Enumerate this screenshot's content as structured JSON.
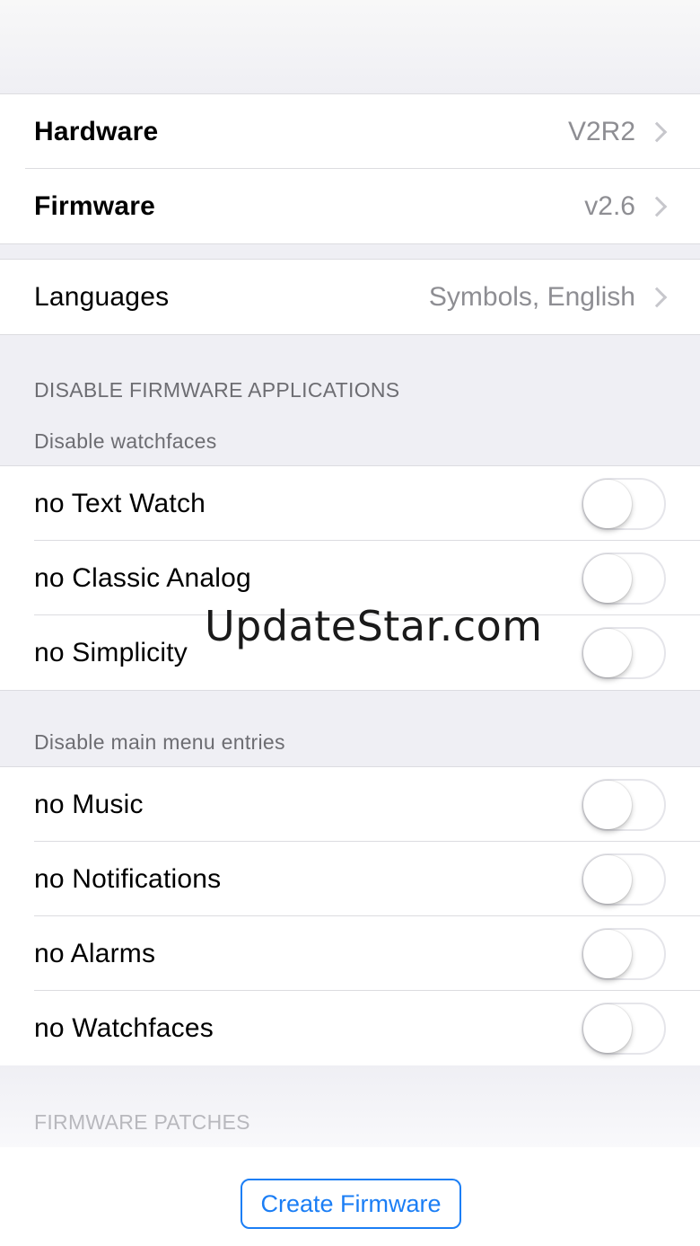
{
  "device": {
    "hardware_label": "Hardware",
    "hardware_value": "V2R2",
    "firmware_label": "Firmware",
    "firmware_value": "v2.6"
  },
  "languages": {
    "label": "Languages",
    "value": "Symbols, English"
  },
  "disable_section": {
    "header": "DISABLE FIRMWARE APPLICATIONS",
    "watchfaces_header": "Disable watchfaces",
    "watchfaces": [
      {
        "label": "no Text Watch",
        "on": false
      },
      {
        "label": "no Classic Analog",
        "on": false
      },
      {
        "label": "no Simplicity",
        "on": false
      }
    ],
    "menu_header": "Disable main menu entries",
    "menu": [
      {
        "label": "no Music",
        "on": false
      },
      {
        "label": "no Notifications",
        "on": false
      },
      {
        "label": "no Alarms",
        "on": false
      },
      {
        "label": "no Watchfaces",
        "on": false
      }
    ]
  },
  "patches_header": "FIRMWARE PATCHES",
  "create_button": "Create Firmware",
  "watermark": "UpdateStar.com",
  "colors": {
    "accent": "#1b7ef5",
    "background": "#efeff4",
    "secondary_text": "#8e8e93"
  }
}
